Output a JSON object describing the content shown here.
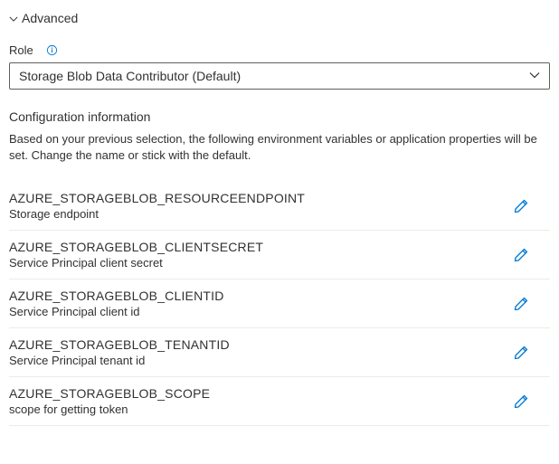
{
  "advanced": {
    "title": "Advanced"
  },
  "role": {
    "label": "Role",
    "selected": "Storage Blob Data Contributor (Default)"
  },
  "config": {
    "heading": "Configuration information",
    "description": "Based on your previous selection, the following environment variables or application properties will be set. Change the name or stick with the default.",
    "items": [
      {
        "key": "AZURE_STORAGEBLOB_RESOURCEENDPOINT",
        "desc": "Storage endpoint"
      },
      {
        "key": "AZURE_STORAGEBLOB_CLIENTSECRET",
        "desc": "Service Principal client secret"
      },
      {
        "key": "AZURE_STORAGEBLOB_CLIENTID",
        "desc": "Service Principal client id"
      },
      {
        "key": "AZURE_STORAGEBLOB_TENANTID",
        "desc": "Service Principal tenant id"
      },
      {
        "key": "AZURE_STORAGEBLOB_SCOPE",
        "desc": "scope for getting token"
      }
    ]
  },
  "colors": {
    "link": "#0078d4"
  }
}
